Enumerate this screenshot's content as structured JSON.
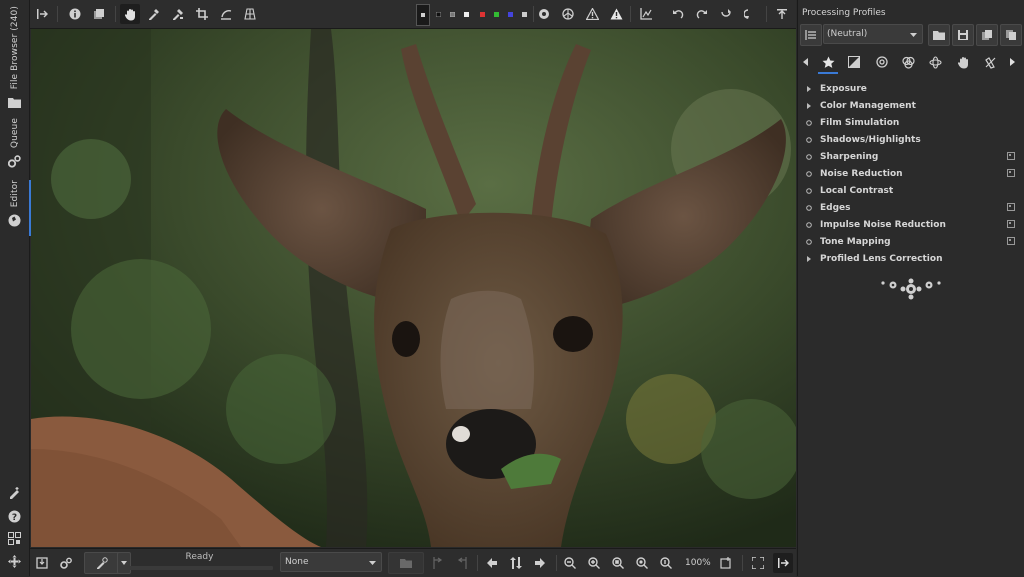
{
  "left_tabs": [
    {
      "label": "File Browser (240)",
      "icon": "folder-icon"
    },
    {
      "label": "Queue",
      "icon": "gears-icon"
    },
    {
      "label": "Editor",
      "icon": "aperture-icon"
    }
  ],
  "left_bottom_icons": [
    "send-to-editor-icon",
    "help-icon",
    "qr-icon",
    "move-icon"
  ],
  "top_toolbar_icons": [
    "panel-toggle-icon",
    "info-icon",
    "snapshot-icon",
    "hand-icon",
    "white-balance-picker-icon",
    "color-picker-icon",
    "crop-icon",
    "straighten-icon",
    "perspective-icon"
  ],
  "preview_modes": [
    "bg-dark",
    "bg-black",
    "bg-grey",
    "bg-white",
    "ch-red",
    "ch-green",
    "ch-blue",
    "ch-lum"
  ],
  "status": {
    "text": "Ready"
  },
  "bottom": {
    "profile_select": "None",
    "zoom": "100%"
  },
  "right_panel": {
    "title": "Processing Profiles",
    "profile_value": "(Neutral)",
    "tools": [
      {
        "label": "Exposure",
        "type": "arrow",
        "pp": false
      },
      {
        "label": "Color Management",
        "type": "arrow",
        "pp": false
      },
      {
        "label": "Film Simulation",
        "type": "circle",
        "pp": false
      },
      {
        "label": "Shadows/Highlights",
        "type": "circle",
        "pp": false
      },
      {
        "label": "Sharpening",
        "type": "circle",
        "pp": true
      },
      {
        "label": "Noise Reduction",
        "type": "circle",
        "pp": true
      },
      {
        "label": "Local Contrast",
        "type": "circle",
        "pp": false
      },
      {
        "label": "Edges",
        "type": "circle",
        "pp": true
      },
      {
        "label": "Impulse Noise Reduction",
        "type": "circle",
        "pp": true
      },
      {
        "label": "Tone Mapping",
        "type": "circle",
        "pp": true
      },
      {
        "label": "Profiled Lens Correction",
        "type": "arrow",
        "pp": false
      }
    ]
  },
  "colors": {
    "accent": "#3a7ad6",
    "panel": "#2b2b2b",
    "toolbar": "#2d2d2d"
  }
}
